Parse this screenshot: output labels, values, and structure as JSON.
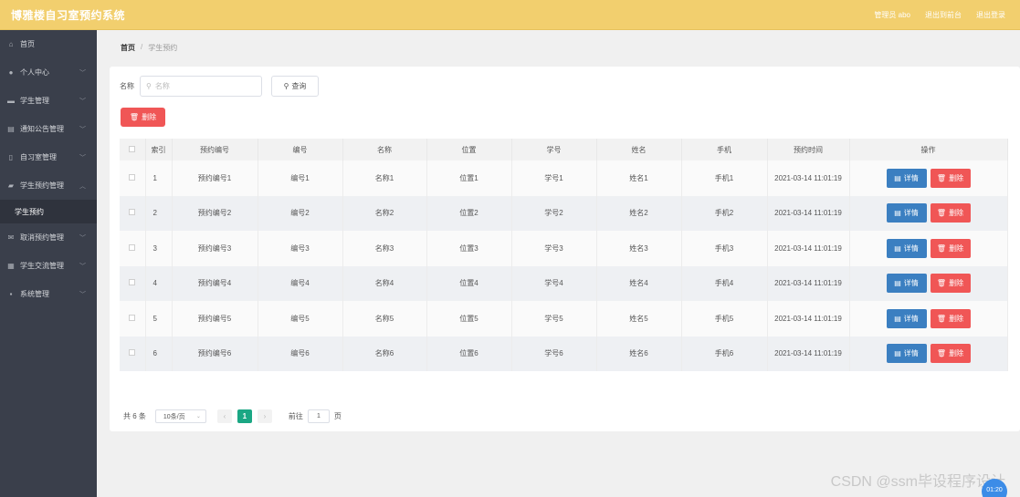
{
  "header": {
    "title": "博雅楼自习室预约系统",
    "admin": "管理员 abo",
    "back_to_front": "退出到前台",
    "logout": "退出登录"
  },
  "sidebar": {
    "items": [
      {
        "label": "首页",
        "icon": "home-icon",
        "chevron": ""
      },
      {
        "label": "个人中心",
        "icon": "user-icon",
        "chevron": "﹀"
      },
      {
        "label": "学生管理",
        "icon": "student-icon",
        "chevron": "﹀"
      },
      {
        "label": "通知公告管理",
        "icon": "notice-icon",
        "chevron": "﹀"
      },
      {
        "label": "自习室管理",
        "icon": "room-icon",
        "chevron": "﹀"
      },
      {
        "label": "学生预约管理",
        "icon": "reservation-icon",
        "chevron": "︿"
      },
      {
        "label": "学生预约",
        "submenu": true
      },
      {
        "label": "取消预约管理",
        "icon": "cancel-icon",
        "chevron": "﹀"
      },
      {
        "label": "学生交流管理",
        "icon": "chat-icon",
        "chevron": "﹀"
      },
      {
        "label": "系统管理",
        "icon": "system-icon",
        "chevron": "﹀"
      }
    ]
  },
  "breadcrumb": {
    "home": "首页",
    "separator": "/",
    "current": "学生预约"
  },
  "search": {
    "label": "名称",
    "placeholder": "名称",
    "button": "查询"
  },
  "toolbar": {
    "delete_label": "删除"
  },
  "table": {
    "headers": [
      "",
      "索引",
      "预约编号",
      "编号",
      "名称",
      "位置",
      "学号",
      "姓名",
      "手机",
      "预约时间",
      "操作"
    ],
    "rows": [
      [
        "1",
        "预约编号1",
        "编号1",
        "名称1",
        "位置1",
        "学号1",
        "姓名1",
        "手机1",
        "2021-03-14 11:01:19"
      ],
      [
        "2",
        "预约编号2",
        "编号2",
        "名称2",
        "位置2",
        "学号2",
        "姓名2",
        "手机2",
        "2021-03-14 11:01:19"
      ],
      [
        "3",
        "预约编号3",
        "编号3",
        "名称3",
        "位置3",
        "学号3",
        "姓名3",
        "手机3",
        "2021-03-14 11:01:19"
      ],
      [
        "4",
        "预约编号4",
        "编号4",
        "名称4",
        "位置4",
        "学号4",
        "姓名4",
        "手机4",
        "2021-03-14 11:01:19"
      ],
      [
        "5",
        "预约编号5",
        "编号5",
        "名称5",
        "位置5",
        "学号5",
        "姓名5",
        "手机5",
        "2021-03-14 11:01:19"
      ],
      [
        "6",
        "预约编号6",
        "编号6",
        "名称6",
        "位置6",
        "学号6",
        "姓名6",
        "手机6",
        "2021-03-14 11:01:19"
      ]
    ],
    "detail_label": "详情",
    "delete_label": "删除"
  },
  "pagination": {
    "total": "共 6 条",
    "page_size": "10条/页",
    "current_page": "1",
    "goto_prefix": "前往",
    "goto_value": "1",
    "goto_suffix": "页"
  },
  "watermark": "CSDN @ssm毕设程序设计",
  "timer": "01:20",
  "colors": {
    "header": "#f2cf6e",
    "sidebar": "#3a3f4b",
    "detail_button": "#3b7fc1",
    "delete_button": "#f05656",
    "active_page": "#1ba784"
  }
}
